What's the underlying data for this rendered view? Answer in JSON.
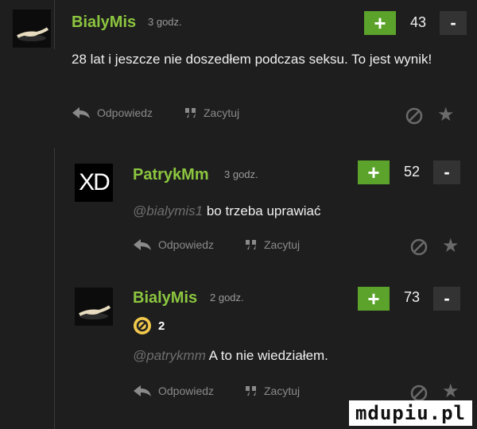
{
  "comments": [
    {
      "username": "BialyMis",
      "time": "3 godz.",
      "score": "43",
      "plus": "+",
      "minus": "-",
      "text": "28 lat i jeszcze nie doszedłem podczas seksu. To jest wynik!",
      "reply": "Odpowiedz",
      "quote": "Zacytuj",
      "avatar_icon": "gecko-avatar"
    },
    {
      "username": "PatrykMm",
      "time": "3 godz.",
      "score": "52",
      "plus": "+",
      "minus": "-",
      "avatar_text": "XD",
      "mention": "@bialymis1",
      "text": " bo trzeba uprawiać",
      "reply": "Odpowiedz",
      "quote": "Zacytuj"
    },
    {
      "username": "BialyMis",
      "time": "2 godz.",
      "score": "73",
      "plus": "+",
      "minus": "-",
      "badge_count": "2",
      "mention": "@patrykmm",
      "text": " A to nie wiedziałem.",
      "reply": "Odpowiedz",
      "quote": "Zacytuj",
      "avatar_icon": "gecko-avatar"
    }
  ],
  "watermark": "mdupiu.pl",
  "colors": {
    "username": "#8cc63f",
    "plus": "#5ba32b",
    "background": "#1e1e1e"
  }
}
